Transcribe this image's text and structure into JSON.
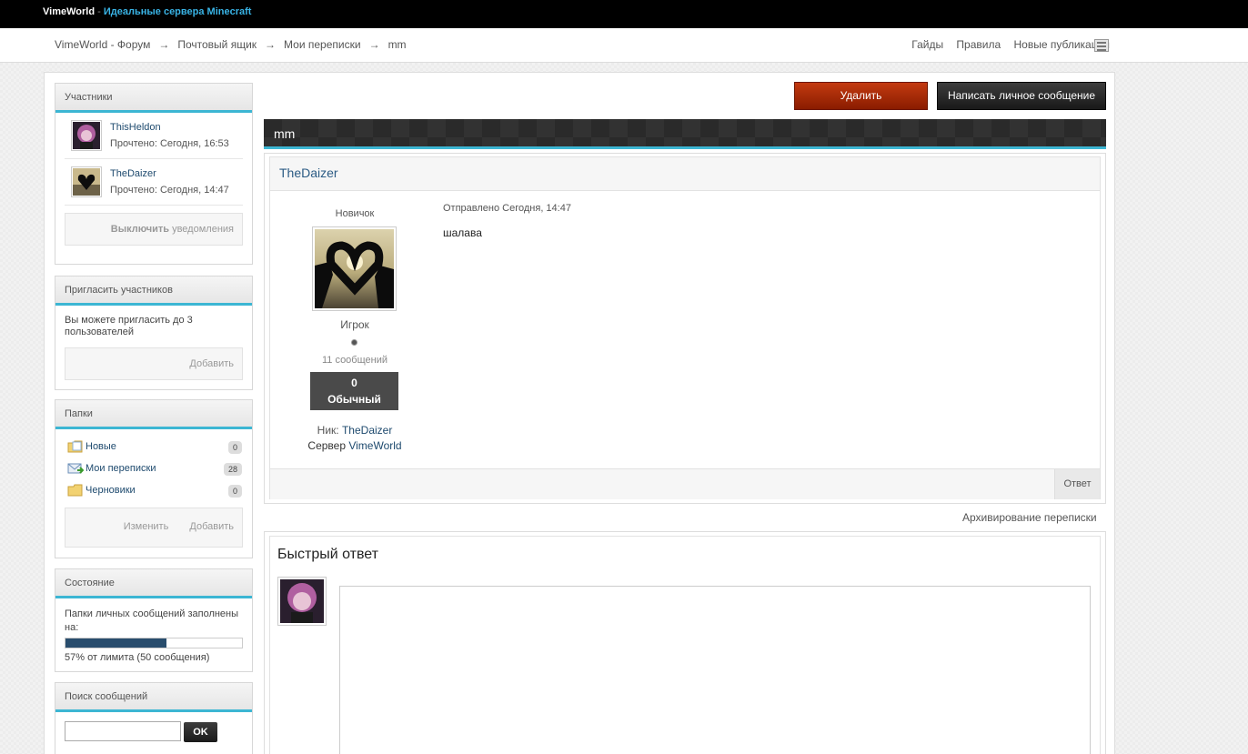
{
  "topbar": {
    "brand": "VimeWorld",
    "separator": "-",
    "tagline": "Идеальные сервера Minecraft"
  },
  "breadcrumb": {
    "items": [
      "VimeWorld - Форум",
      "Почтовый ящик",
      "Мои переписки",
      "mm"
    ],
    "arrow": "→"
  },
  "toplinks": [
    "Гайды",
    "Правила",
    "Новые публикации"
  ],
  "sidebar": {
    "participants": {
      "title": "Участники",
      "members": [
        {
          "name": "ThisHeldon",
          "status": "Прочтено: Сегодня, 16:53"
        },
        {
          "name": "TheDaizer",
          "status": "Прочтено: Сегодня, 14:47"
        }
      ],
      "notify_bold": "Выключить",
      "notify_rest": " уведомления"
    },
    "invite": {
      "title": "Пригласить участников",
      "text": "Вы можете пригласить до 3 пользователей",
      "add_label": "Добавить"
    },
    "folders": {
      "title": "Папки",
      "items": [
        {
          "label": "Новые",
          "count": "0"
        },
        {
          "label": "Мои переписки",
          "count": "28"
        },
        {
          "label": "Черновики",
          "count": "0"
        }
      ],
      "edit_label": "Изменить",
      "add_label": "Добавить"
    },
    "status": {
      "title": "Состояние",
      "text": "Папки личных сообщений заполнены на:",
      "progress": 0.57,
      "progress_text": "57% от лимита (50 сообщения)"
    },
    "search": {
      "title": "Поиск сообщений",
      "value": "",
      "ok_label": "OK"
    }
  },
  "actions": {
    "delete_label": "Удалить",
    "compose_label": "Написать личное сообщение"
  },
  "topic": {
    "title": "mm"
  },
  "post": {
    "author": "TheDaizer",
    "author_title": "Новичок",
    "group": "Игрок",
    "post_count": "11 сообщений",
    "reputation_value": "0",
    "reputation_level": "Обычный",
    "nick_label": "Ник: ",
    "nick_value": "TheDaizer",
    "server_label": "Сервер ",
    "server_value": "VimeWorld",
    "date": "Отправлено Сегодня, 14:47",
    "text": "шалава",
    "reply_label": "Ответ"
  },
  "archive_label": "Архивирование переписки",
  "quick_reply": {
    "title": "Быстрый ответ"
  },
  "colors": {
    "accent": "#3cb6d3",
    "delete": "#b3300b",
    "dark": "#222222",
    "link": "#1e4a6e"
  }
}
